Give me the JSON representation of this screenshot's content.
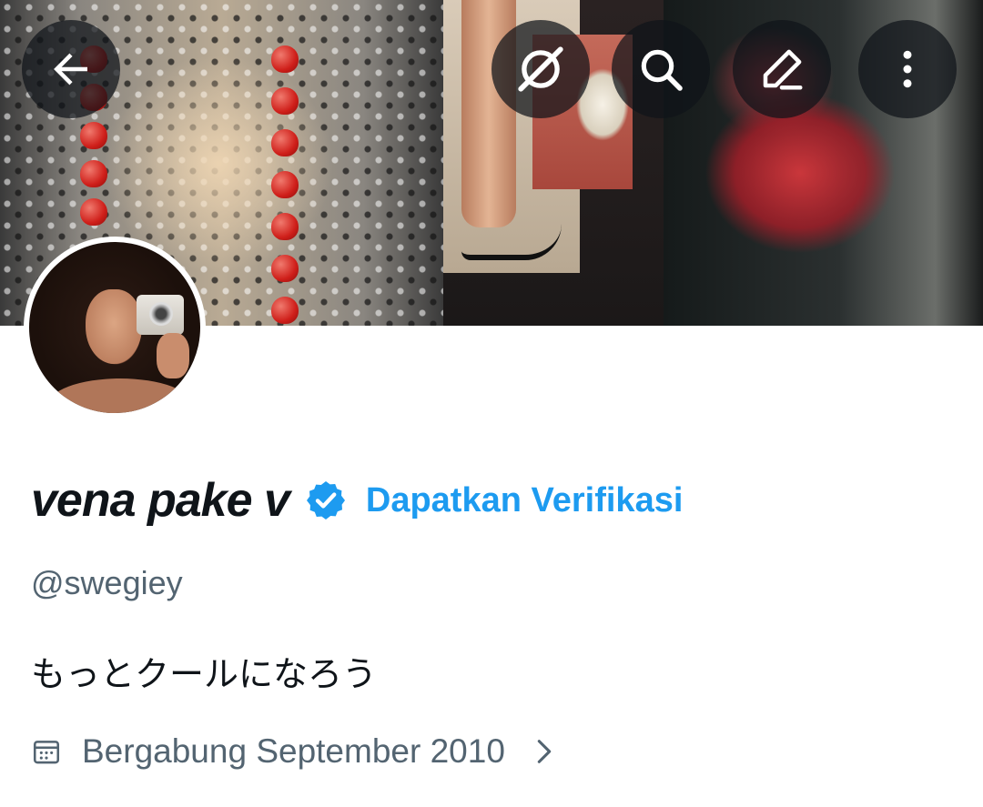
{
  "header": {
    "buttons": [
      {
        "name": "back",
        "icon": "arrow-left-icon"
      },
      {
        "name": "grok",
        "icon": "grok-icon"
      },
      {
        "name": "search",
        "icon": "search-icon"
      },
      {
        "name": "edit",
        "icon": "pencil-icon"
      },
      {
        "name": "more",
        "icon": "more-vertical-icon"
      }
    ]
  },
  "profile": {
    "display_name": "vena pake v",
    "verified_icon": "verified-badge-icon",
    "get_verified_label": "Dapatkan Verifikasi",
    "handle": "@swegiey",
    "bio": "もっとクールになろう",
    "joined": "Bergabung September 2010"
  },
  "colors": {
    "accent": "#1d9bf0",
    "text_primary": "#0f1419",
    "text_secondary": "#536471",
    "overlay_button": "#0f1419"
  }
}
